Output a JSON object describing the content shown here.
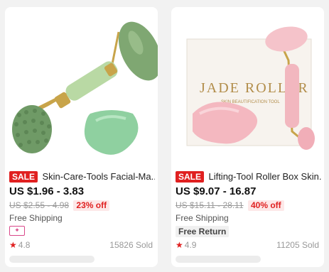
{
  "products": [
    {
      "sale_badge": "SALE",
      "title": "Skin-Care-Tools Facial-Ma...",
      "price": "US $1.96 - 3.83",
      "original_price": "US $2.55 - 4.98",
      "discount": "23% off",
      "shipping": "Free Shipping",
      "rating": "4.8",
      "sold": "15826 Sold"
    },
    {
      "sale_badge": "SALE",
      "title": "Lifting-Tool Roller Box Skin...",
      "price": "US $9.07 - 16.87",
      "original_price": "US $15.11 - 28.11",
      "discount": "40% off",
      "shipping": "Free Shipping",
      "extra_badge": "Free Return",
      "rating": "4.9",
      "sold": "11205 Sold",
      "box_text": "JADE ROLLER",
      "box_subtext": "SKIN BEAUTIFICATION TOOL"
    }
  ],
  "colors": {
    "sale": "#e02020",
    "jade": "#8ac9a0",
    "rose": "#f4b8c0"
  }
}
